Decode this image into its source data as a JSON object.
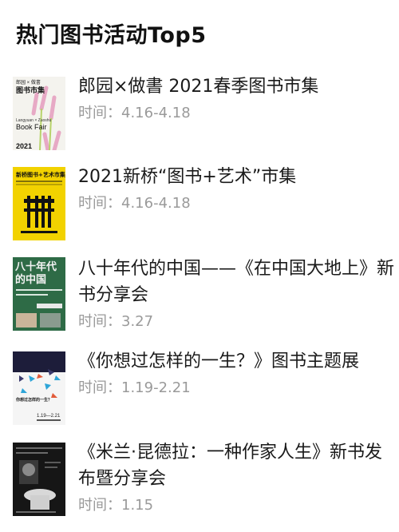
{
  "header": {
    "title": "热门图书活动Top5"
  },
  "time_label": "时间：",
  "events": [
    {
      "title": "郎园×做書 2021春季图书市集",
      "time": "4.16-4.18",
      "cover_text": [
        "郎园 × 做書",
        "图书市集",
        "Langyuan × Zuoshu",
        "Book Fair",
        "2021"
      ]
    },
    {
      "title": "2021新桥“图书+艺术”市集",
      "time": "4.16-4.18",
      "cover_text": [
        "新桥图书+艺术市集"
      ]
    },
    {
      "title": "八十年代的中国——《在中国大地上》新书分享会",
      "time": "3.27",
      "cover_text": [
        "八十年代",
        "的中国"
      ]
    },
    {
      "title": "《你想过怎样的一生？》图书主题展",
      "time": "1.19-2.21",
      "cover_text": [
        "你想过怎样的一生？",
        "1.19—2.21"
      ]
    },
    {
      "title": "《米兰·昆德拉：一种作家人生》新书发布暨分享会",
      "time": "1.15",
      "cover_text": []
    }
  ],
  "colors": {
    "title": "#111111",
    "time": "#9a9a9a",
    "cover2_bg": "#f2d200",
    "cover3_bg": "#2e6b46",
    "cover5_bg": "#161616"
  }
}
